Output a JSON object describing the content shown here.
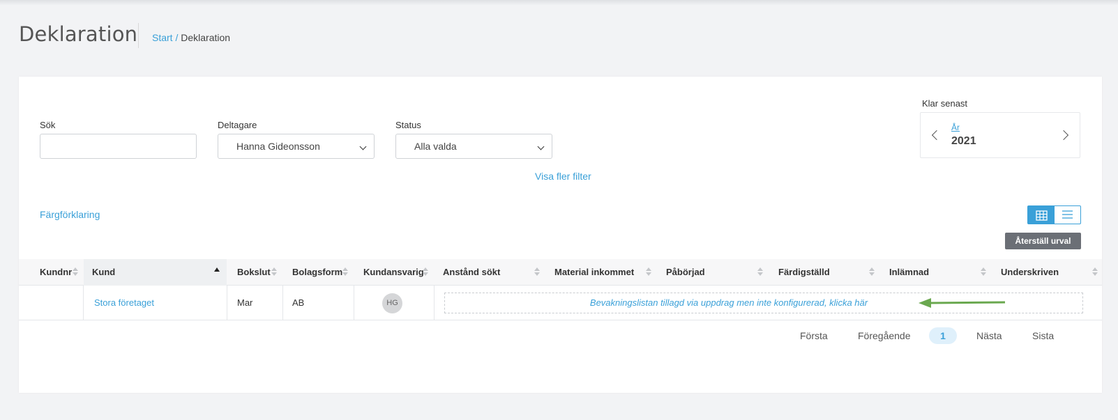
{
  "page": {
    "title": "Deklaration",
    "breadcrumb": {
      "home": "Start",
      "separator": "/",
      "current": "Deklaration"
    }
  },
  "filters": {
    "search": {
      "label": "Sök",
      "value": "",
      "placeholder": ""
    },
    "participant": {
      "label": "Deltagare",
      "value": "Hanna Gideonsson"
    },
    "status": {
      "label": "Status",
      "value": "Alla valda"
    },
    "more_filters_link": "Visa fler filter",
    "deadline": {
      "label": "Klar senast",
      "unit": "År",
      "year": "2021"
    }
  },
  "color_legend_link": "Färgförklaring",
  "view_modes": {
    "grid_icon": "grid-icon",
    "list_icon": "list-icon",
    "active": "grid"
  },
  "reset_button": "Återställ urval",
  "table": {
    "columns": [
      "Kundnr",
      "Kund",
      "Bokslut",
      "Bolagsform",
      "Kundansvarig",
      "Anstånd sökt",
      "Material inkommet",
      "Påbörjad",
      "Färdigställd",
      "Inlämnad",
      "Underskriven"
    ],
    "sorted_column": "Kund",
    "rows": [
      {
        "kundnr": "",
        "kund": "Stora företaget",
        "bokslut": "Mar",
        "bolagsform": "AB",
        "kundansvarig": "HG",
        "notice": "Bevakningslistan tillagd via uppdrag men inte konfigurerad, klicka här"
      }
    ]
  },
  "pagination": {
    "first": "Första",
    "previous": "Föregående",
    "current": "1",
    "next": "Nästa",
    "last": "Sista"
  },
  "colors": {
    "accent": "#3aa0d8",
    "arrow": "#6aa84f",
    "reset_bg": "#6b6f76"
  }
}
